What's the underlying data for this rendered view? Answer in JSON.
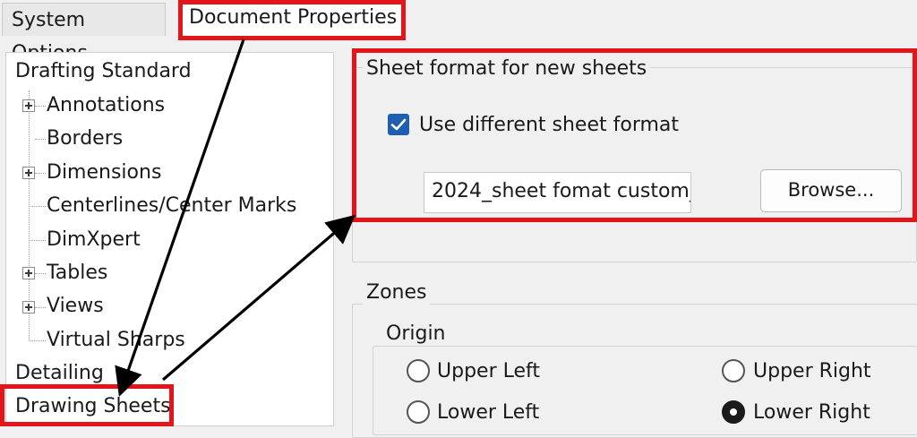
{
  "tabs": {
    "system_options": "System Options",
    "document_properties": "Document Properties"
  },
  "tree": {
    "items": [
      {
        "label": "Drafting Standard"
      },
      {
        "label": "Annotations"
      },
      {
        "label": "Borders"
      },
      {
        "label": "Dimensions"
      },
      {
        "label": "Centerlines/Center Marks"
      },
      {
        "label": "DimXpert"
      },
      {
        "label": "Tables"
      },
      {
        "label": "Views"
      },
      {
        "label": "Virtual Sharps"
      },
      {
        "label": "Detailing"
      },
      {
        "label": "Drawing Sheets"
      }
    ]
  },
  "sheet_format": {
    "title": "Sheet format for new sheets",
    "checkbox_label": "Use different sheet format",
    "checked": true,
    "path_value": "2024_sheet fomat custom_",
    "browse_label": "Browse..."
  },
  "zones": {
    "title": "Zones",
    "origin_title": "Origin",
    "options": [
      {
        "label": "Upper Left",
        "selected": false
      },
      {
        "label": "Upper Right",
        "selected": false
      },
      {
        "label": "Lower Left",
        "selected": false
      },
      {
        "label": "Lower Right",
        "selected": true
      }
    ]
  },
  "annotation_color": "#e4141b",
  "accent_color": "#1f5fb3"
}
